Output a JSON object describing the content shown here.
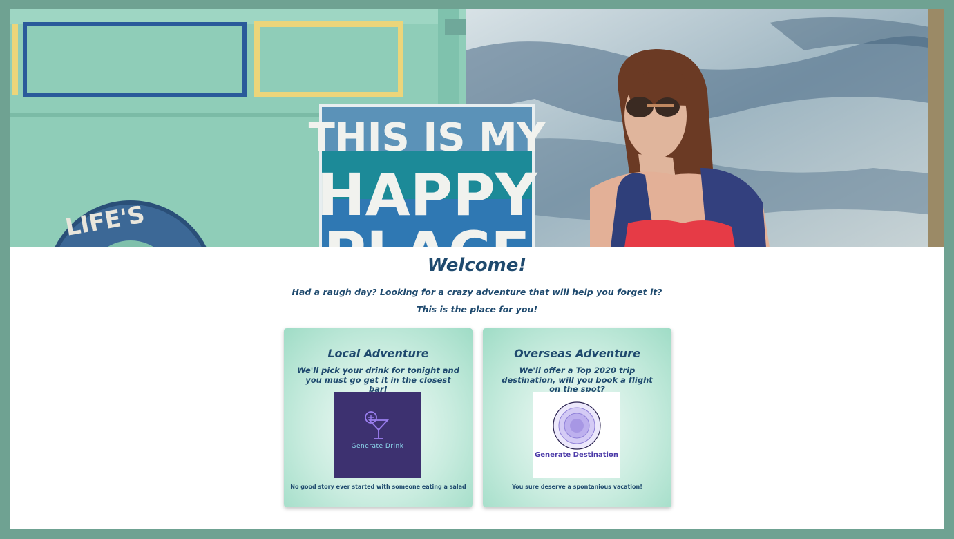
{
  "hero": {
    "sign_line_1": "THIS IS MY",
    "sign_line_2": "HAPPY",
    "sign_line_3": "PLACE",
    "lifebuoy_text": "LIFE'S"
  },
  "welcome": {
    "title": "Welcome!",
    "line_1": "Had a raugh day? Looking for a crazy adventure that will help you forget it?",
    "line_2": "This is the place for you!"
  },
  "cards": {
    "local": {
      "title": "Local Adventure",
      "text": "We'll pick your drink for tonight and you must go get it in the closest bar!",
      "button_label": "Generate Drink",
      "button_icon": "cocktail-icon",
      "footer": "No good story ever started with someone eating a salad"
    },
    "overseas": {
      "title": "Overseas Adventure",
      "text": "We'll offer a Top 2020 trip destination, will you book a flight on the spot?",
      "button_label": "Generate Destination",
      "button_icon": "globe-rings-icon",
      "footer": "You sure deserve a spontanious vacation!"
    }
  },
  "colors": {
    "frame": "#6fa292",
    "heading": "#1f4a6e",
    "drink_button": "#3d3170",
    "destination_label": "#4b3aa8"
  }
}
